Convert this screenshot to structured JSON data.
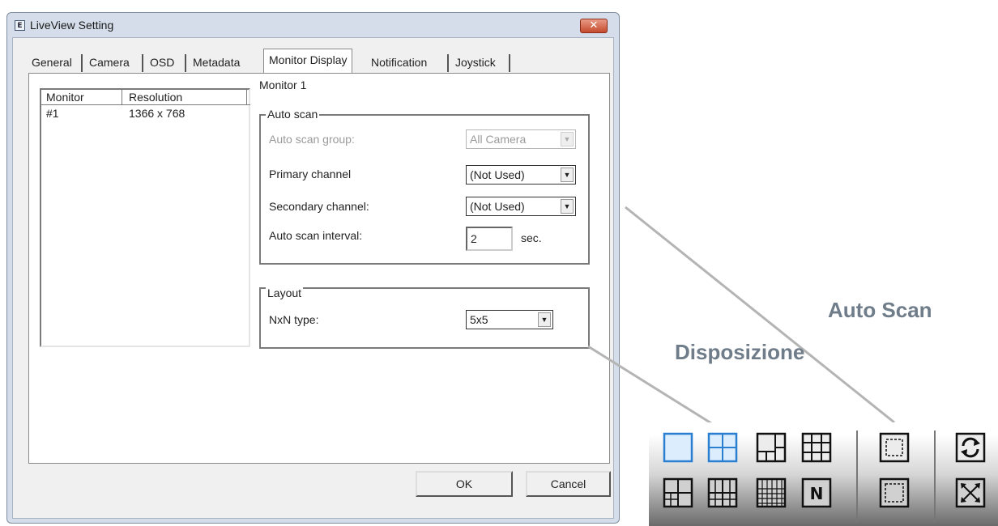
{
  "window": {
    "title": "LiveView Setting",
    "close_glyph": "✕"
  },
  "tabs": [
    "General",
    "Camera",
    "OSD",
    "Metadata",
    "Monitor Display",
    "Notification",
    "Joystick"
  ],
  "active_tab": "Monitor Display",
  "monitor_list": {
    "headers": [
      "Monitor",
      "Resolution"
    ],
    "rows": [
      {
        "monitor": "#1",
        "resolution": "1366 x 768"
      }
    ]
  },
  "monitor_title": "Monitor 1",
  "auto_scan": {
    "legend": "Auto scan",
    "group_label": "Auto scan group:",
    "group_value": "All Camera",
    "primary_label": "Primary channel",
    "primary_value": "(Not Used)",
    "secondary_label": "Secondary channel:",
    "secondary_value": "(Not Used)",
    "interval_label": "Auto scan interval:",
    "interval_value": "2",
    "interval_unit": "sec."
  },
  "layout": {
    "legend": "Layout",
    "nxn_label": "NxN type:",
    "nxn_value": "5x5"
  },
  "buttons": {
    "ok": "OK",
    "cancel": "Cancel"
  },
  "callouts": {
    "auto_scan": "Auto Scan",
    "layout": "Disposizione"
  },
  "toolbar": {
    "icons": [
      "single-view-icon",
      "quad-view-icon",
      "layout-1plus5-icon",
      "grid-3x3-icon",
      "grid-4x4-icon",
      "grid-5x5-icon",
      "grid-6x6-icon",
      "nxn-layout-icon",
      "sequence-icon",
      "fit-screen-icon",
      "auto-scan-icon",
      "full-screen-icon"
    ],
    "nxn_glyph": "N"
  },
  "colors": {
    "accent_blue": "#3a8fd6",
    "callout_gray": "#6f7c8a"
  }
}
